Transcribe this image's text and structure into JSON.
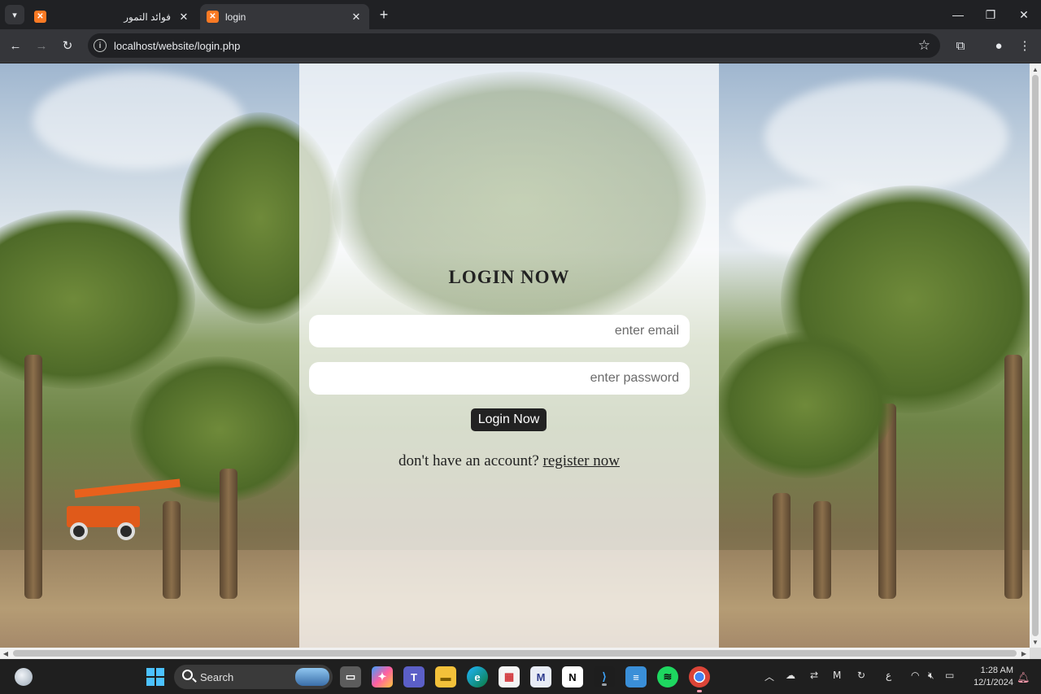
{
  "browser": {
    "tabs": [
      {
        "title": "فوائد التمور",
        "active": false,
        "favicon": "xampp-icon"
      },
      {
        "title": "login",
        "active": true,
        "favicon": "xampp-icon"
      }
    ],
    "address": "localhost/website/login.php"
  },
  "login": {
    "title": "LOGIN NOW",
    "email_placeholder": "enter email",
    "password_placeholder": "enter password",
    "button_label": "Login Now",
    "register_prompt": "don't have an account?",
    "register_link": "register now"
  },
  "taskbar": {
    "search_label": "Search",
    "tray_language": "ع",
    "time": "1:28 AM",
    "date": "12/1/2024"
  },
  "colors": {
    "accent": "#fb7a24",
    "button_bg": "#222222",
    "panel_overlay": "rgba(255,255,255,0.72)"
  }
}
